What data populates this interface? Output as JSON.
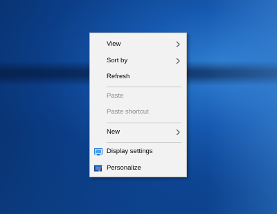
{
  "context_menu": {
    "items": [
      {
        "label": "View",
        "submenu": true,
        "enabled": true
      },
      {
        "label": "Sort by",
        "submenu": true,
        "enabled": true
      },
      {
        "label": "Refresh",
        "submenu": false,
        "enabled": true
      },
      {
        "label": "Paste",
        "submenu": false,
        "enabled": false
      },
      {
        "label": "Paste shortcut",
        "submenu": false,
        "enabled": false
      },
      {
        "label": "New",
        "submenu": true,
        "enabled": true
      },
      {
        "label": "Display settings",
        "icon": "display-settings-icon",
        "enabled": true
      },
      {
        "label": "Personalize",
        "icon": "personalize-icon",
        "enabled": true
      }
    ]
  },
  "colors": {
    "desktop_accent": "#1659b0",
    "menu_background": "#f2f2f2",
    "disabled_text": "#8a8a8a"
  }
}
